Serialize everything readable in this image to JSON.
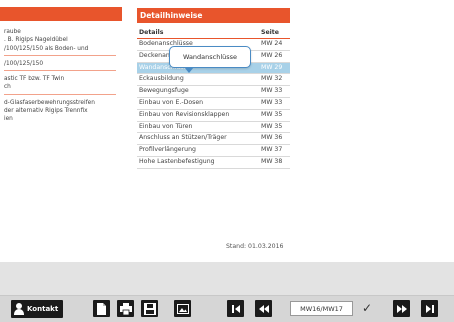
{
  "left": {
    "lines": [
      "raube",
      ". B. Rigips Nageldübel",
      "/100/125/150 als Boden- und",
      "",
      "/100/125/150",
      "",
      "astic TF bzw. TF Twin",
      "ch",
      "d-Glasfaserbewehrungsstreifen",
      "der alternativ Rigips Trennfix",
      "ien"
    ]
  },
  "panel": {
    "title": "Detailhinweise",
    "col_details": "Details",
    "col_seite": "Seite",
    "rows": [
      {
        "detail": "Bodenanschlüsse",
        "seite": "MW 24"
      },
      {
        "detail": "Deckenanschlüsse",
        "seite": "MW 26"
      },
      {
        "detail": "Wandanschlüsse",
        "seite": "MW 29",
        "highlighted": true
      },
      {
        "detail": "Eckausbildung",
        "seite": "MW 32"
      },
      {
        "detail": "Bewegungsfuge",
        "seite": "MW 33"
      },
      {
        "detail": "Einbau von E.-Dosen",
        "seite": "MW 33"
      },
      {
        "detail": "Einbau von Revisionsklappen",
        "seite": "MW 35"
      },
      {
        "detail": "Einbau von Türen",
        "seite": "MW 35"
      },
      {
        "detail": "Anschluss an Stützen/Träger",
        "seite": "MW 36"
      },
      {
        "detail": "Profilverlängerung",
        "seite": "MW 37"
      },
      {
        "detail": "Hohe Lastenbefestigung",
        "seite": "MW 38"
      }
    ],
    "tooltip": "Wandanschlüsse",
    "stand": "Stand: 01.03.2016"
  },
  "toolbar": {
    "kontakt_label": "Kontakt",
    "page_value": "MW16/MW17",
    "icons": [
      "document-icon",
      "print-icon",
      "save-icon",
      "image-icon",
      "first-page-icon",
      "rewind-icon",
      "confirm-check-icon",
      "fast-forward-icon",
      "last-page-icon"
    ]
  },
  "colors": {
    "accent": "#e8552c",
    "highlight": "#a8d1e8",
    "button": "#1b1b1b"
  }
}
